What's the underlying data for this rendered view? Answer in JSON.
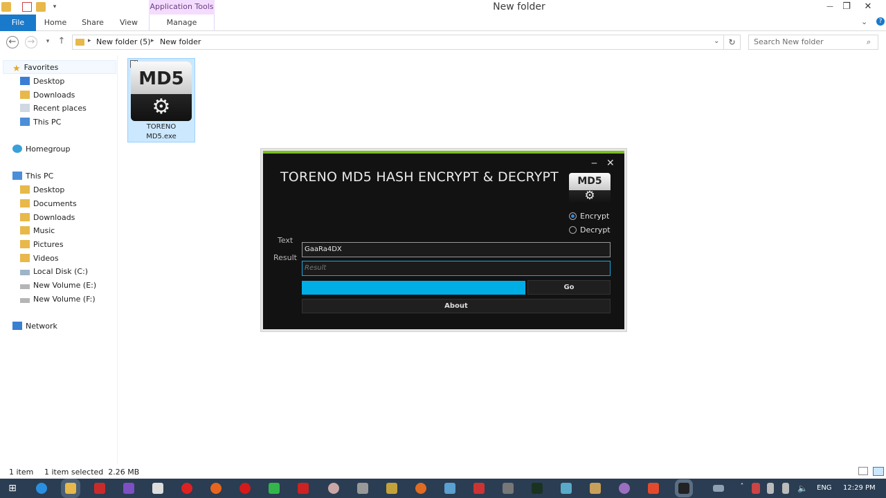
{
  "window": {
    "title": "New folder",
    "app_tools_label": "Application Tools",
    "controls": {
      "minimize": "—",
      "maximize": "❐",
      "close": "✕"
    }
  },
  "ribbon": {
    "tabs": [
      {
        "label": "File"
      },
      {
        "label": "Home"
      },
      {
        "label": "Share"
      },
      {
        "label": "View"
      },
      {
        "label": "Manage"
      }
    ]
  },
  "address": {
    "crumbs": [
      "New folder (5)",
      "New folder"
    ],
    "search_placeholder": "Search New folder"
  },
  "nav": {
    "favorites_label": "Favorites",
    "favorites": [
      "Desktop",
      "Downloads",
      "Recent places",
      "This PC"
    ],
    "homegroup_label": "Homegroup",
    "thispc_label": "This PC",
    "thispc_items": [
      "Desktop",
      "Documents",
      "Downloads",
      "Music",
      "Pictures",
      "Videos",
      "Local Disk (C:)",
      "New Volume (E:)",
      "New Volume (F:)"
    ],
    "network_label": "Network"
  },
  "file": {
    "name_line1": "TORENO",
    "name_line2": "MD5.exe",
    "logo_text": "MD5"
  },
  "dialog": {
    "title": "TORENO MD5 HASH ENCRYPT & DECRYPT",
    "logo_text": "MD5",
    "radio_encrypt": "Encrypt",
    "radio_decrypt": "Decrypt",
    "selected_mode": "Encrypt",
    "text_label": "Text",
    "result_label": "Result",
    "text_value": "GaaRa4DX",
    "result_placeholder": "Result",
    "go_label": "Go",
    "about_label": "About"
  },
  "status": {
    "item_count": "1 item",
    "selected": "1 item selected  2.26 MB"
  },
  "taskbar": {
    "lang": "ENG",
    "time": "12:29 PM"
  }
}
